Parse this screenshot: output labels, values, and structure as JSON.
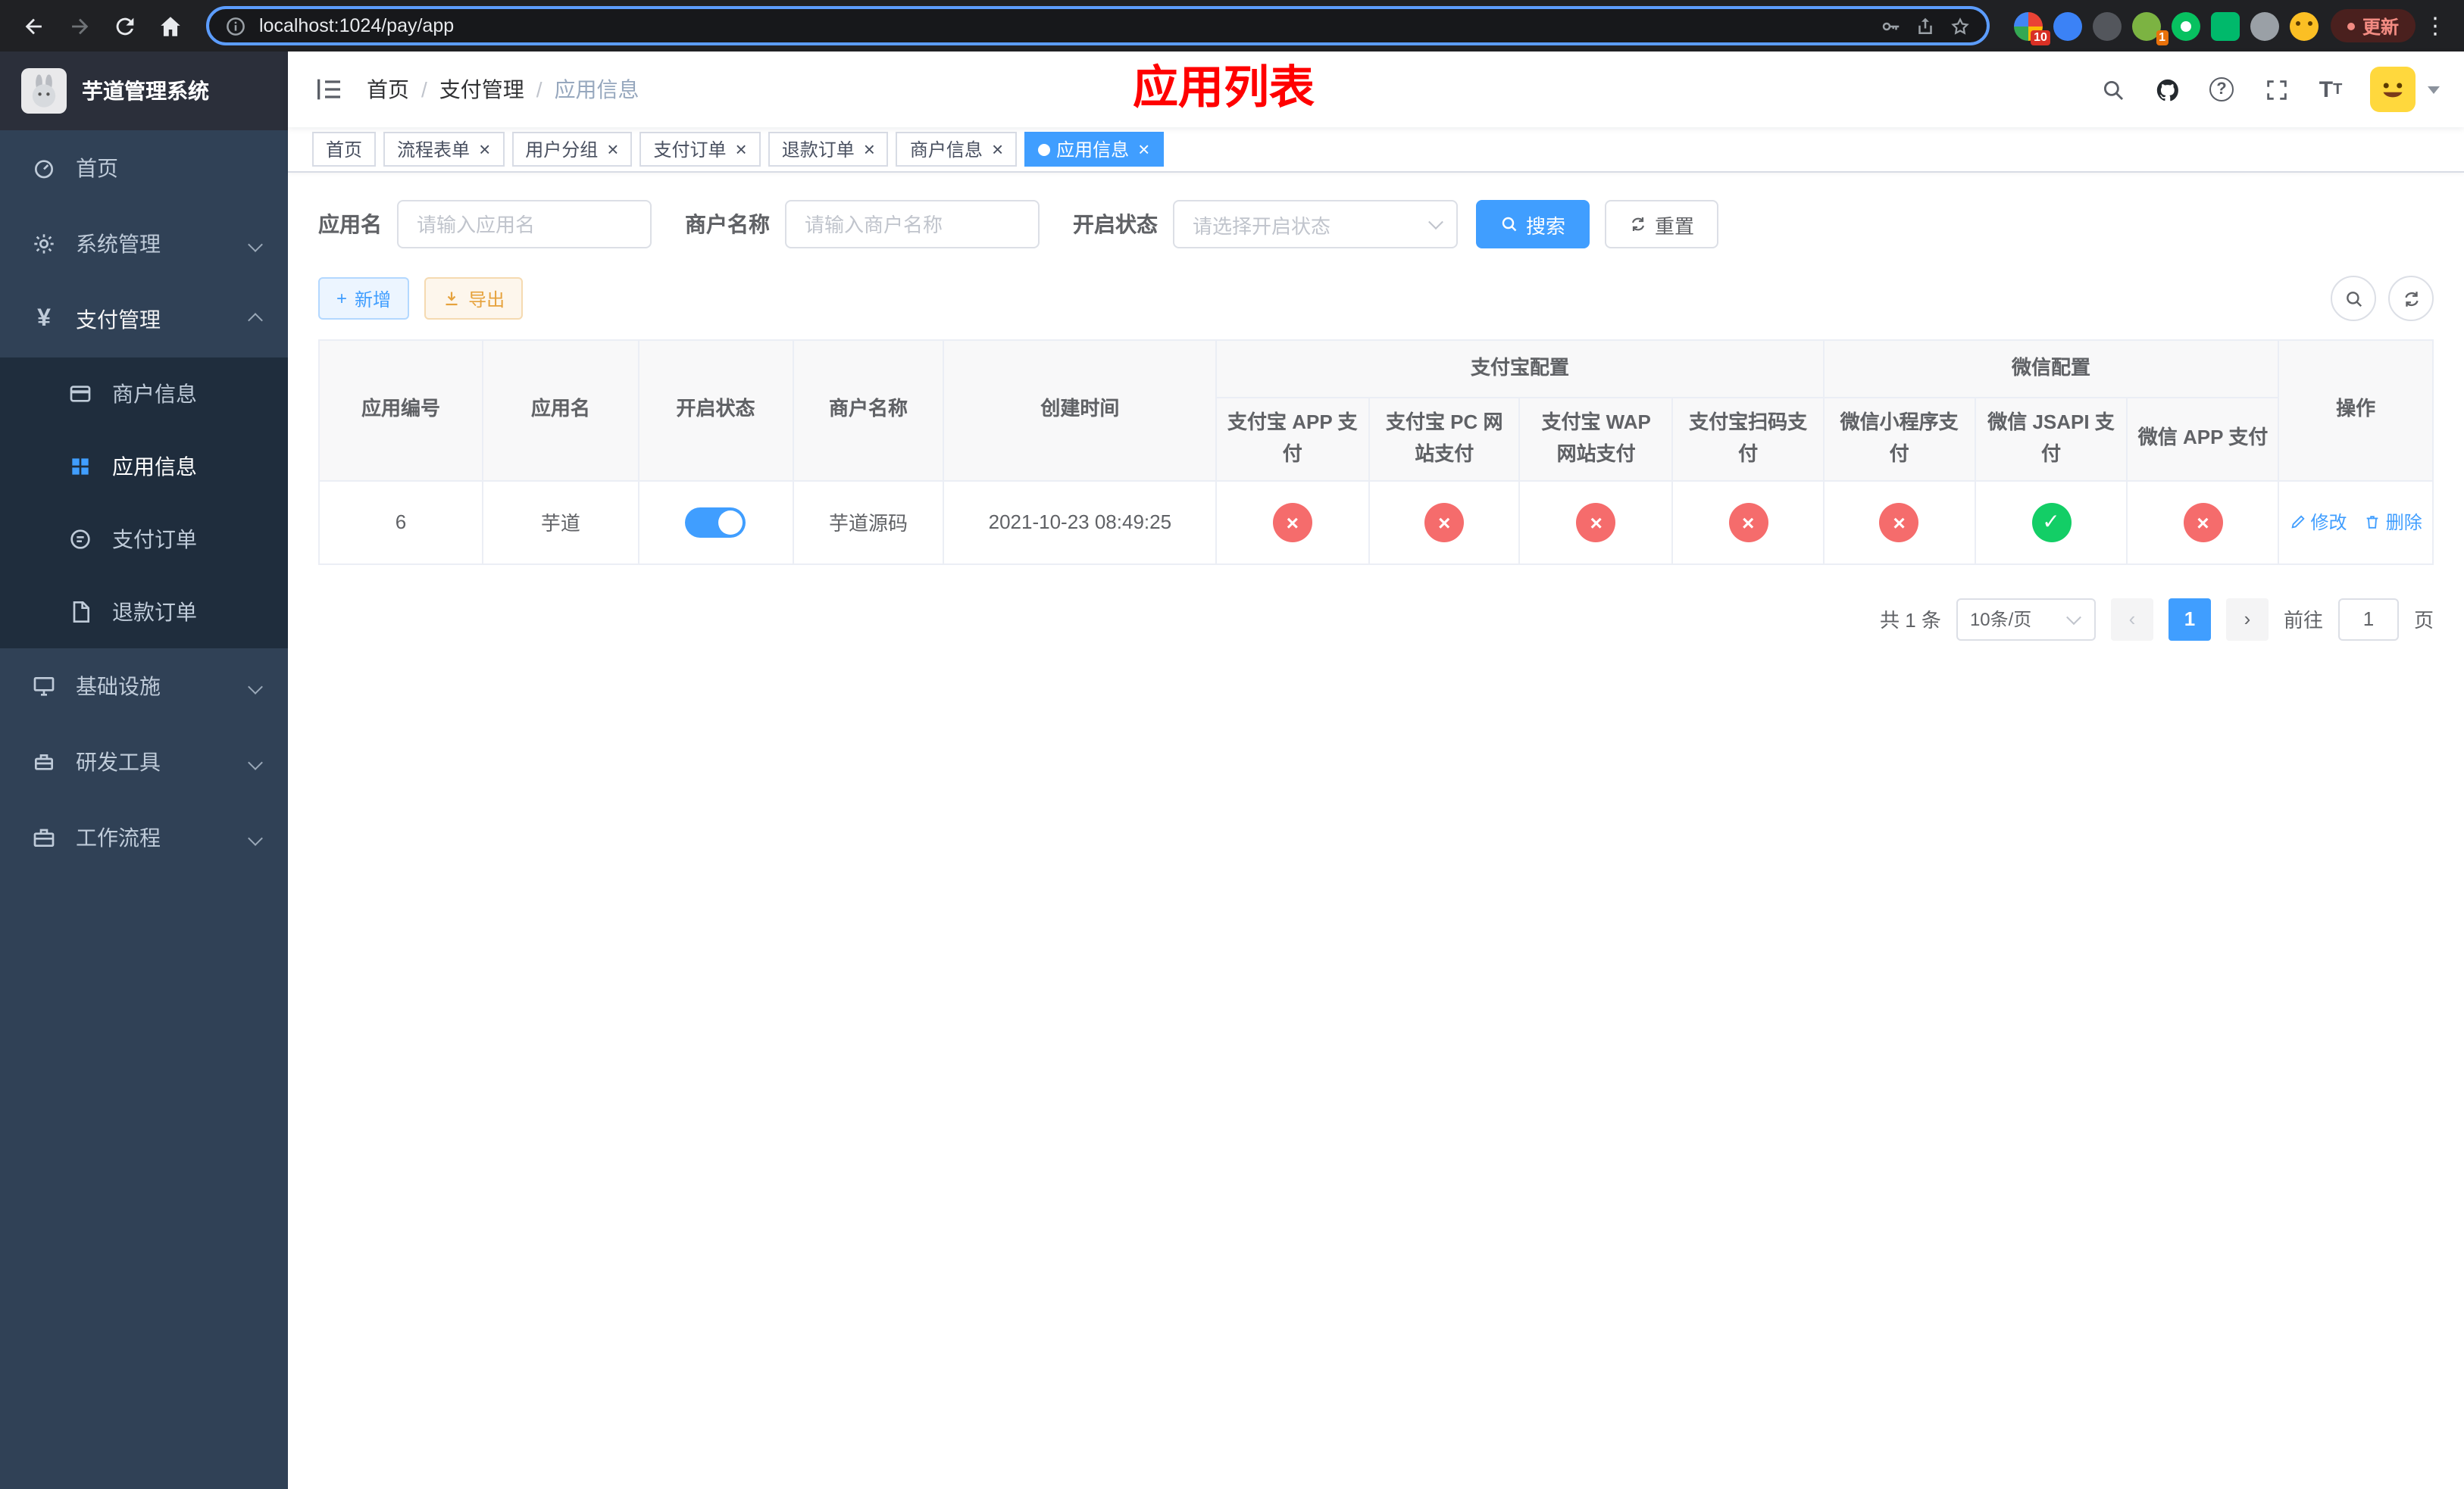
{
  "browser": {
    "url": "localhost:1024/pay/app",
    "update_label": "更新",
    "extension_badges": {
      "pinwheel": "10",
      "avocado": "1"
    }
  },
  "sidebar": {
    "logo_title": "芋道管理系统",
    "menu": [
      {
        "label": "首页"
      },
      {
        "label": "系统管理"
      },
      {
        "label": "支付管理"
      },
      {
        "label": "商户信息"
      },
      {
        "label": "应用信息"
      },
      {
        "label": "支付订单"
      },
      {
        "label": "退款订单"
      },
      {
        "label": "基础设施"
      },
      {
        "label": "研发工具"
      },
      {
        "label": "工作流程"
      }
    ]
  },
  "header": {
    "breadcrumb": [
      {
        "label": "首页"
      },
      {
        "label": "支付管理"
      },
      {
        "label": "应用信息"
      }
    ],
    "page_title": "应用列表"
  },
  "tabs": [
    {
      "label": "首页"
    },
    {
      "label": "流程表单"
    },
    {
      "label": "用户分组"
    },
    {
      "label": "支付订单"
    },
    {
      "label": "退款订单"
    },
    {
      "label": "商户信息"
    },
    {
      "label": "应用信息"
    }
  ],
  "filters": {
    "app_name_label": "应用名",
    "app_name_placeholder": "请输入应用名",
    "merchant_label": "商户名称",
    "merchant_placeholder": "请输入商户名称",
    "status_label": "开启状态",
    "status_placeholder": "请选择开启状态",
    "search_label": "搜索",
    "reset_label": "重置"
  },
  "toolbar": {
    "add_label": "新增",
    "export_label": "导出"
  },
  "table": {
    "headers": {
      "id": "应用编号",
      "name": "应用名",
      "status": "开启状态",
      "merchant": "商户名称",
      "created": "创建时间",
      "alipay_group": "支付宝配置",
      "alipay_app": "支付宝 APP 支付",
      "alipay_pc": "支付宝 PC 网站支付",
      "alipay_wap": "支付宝 WAP 网站支付",
      "alipay_qr": "支付宝扫码支付",
      "wechat_group": "微信配置",
      "wx_mini": "微信小程序支付",
      "wx_jsapi": "微信 JSAPI 支付",
      "wx_app": "微信 APP 支付",
      "actions": "操作"
    },
    "rows": [
      {
        "id": "6",
        "name": "芋道",
        "enabled": true,
        "merchant": "芋道源码",
        "created": "2021-10-23 08:49:25",
        "alipay_app": false,
        "alipay_pc": false,
        "alipay_wap": false,
        "alipay_qr": false,
        "wx_mini": false,
        "wx_jsapi": true,
        "wx_app": false,
        "edit_label": "修改",
        "delete_label": "删除"
      }
    ]
  },
  "pagination": {
    "total": "共 1 条",
    "page_size": "10条/页",
    "current_page": "1",
    "goto_label": "前往",
    "goto_value": "1",
    "page_unit": "页"
  },
  "colors": {
    "primary": "#409eff",
    "success": "#13ce66",
    "danger": "#f56c6c",
    "warning": "#e6a23c",
    "title_red": "#ff0000"
  }
}
